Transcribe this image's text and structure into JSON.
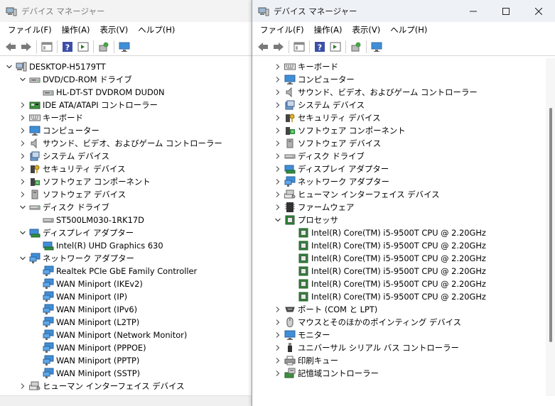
{
  "left": {
    "title": "デバイス マネージャー",
    "menu": [
      "ファイル(F)",
      "操作(A)",
      "表示(V)",
      "ヘルプ(H)"
    ],
    "tree": [
      {
        "level": 0,
        "exp": "open",
        "icon": "computer-icon",
        "label": "DESKTOP-H5179TT"
      },
      {
        "level": 1,
        "exp": "open",
        "icon": "dvd-drive-icon",
        "label": "DVD/CD-ROM ドライブ"
      },
      {
        "level": 2,
        "exp": "",
        "icon": "dvd-drive-icon",
        "label": "HL-DT-ST DVDROM DUD0N"
      },
      {
        "level": 1,
        "exp": "closed",
        "icon": "ide-controller-icon",
        "label": "IDE ATA/ATAPI コントローラー"
      },
      {
        "level": 1,
        "exp": "closed",
        "icon": "keyboard-icon",
        "label": "キーボード"
      },
      {
        "level": 1,
        "exp": "closed",
        "icon": "monitor-icon",
        "label": "コンピューター"
      },
      {
        "level": 1,
        "exp": "closed",
        "icon": "speaker-icon",
        "label": "サウンド、ビデオ、およびゲーム コントローラー"
      },
      {
        "level": 1,
        "exp": "closed",
        "icon": "system-device-icon",
        "label": "システム デバイス"
      },
      {
        "level": 1,
        "exp": "closed",
        "icon": "security-device-icon",
        "label": "セキュリティ デバイス"
      },
      {
        "level": 1,
        "exp": "closed",
        "icon": "software-component-icon",
        "label": "ソフトウェア コンポーネント"
      },
      {
        "level": 1,
        "exp": "closed",
        "icon": "software-device-icon",
        "label": "ソフトウェア デバイス"
      },
      {
        "level": 1,
        "exp": "open",
        "icon": "disk-drive-icon",
        "label": "ディスク ドライブ"
      },
      {
        "level": 2,
        "exp": "",
        "icon": "disk-drive-icon",
        "label": "ST500LM030-1RK17D"
      },
      {
        "level": 1,
        "exp": "open",
        "icon": "display-adapter-icon",
        "label": "ディスプレイ アダプター"
      },
      {
        "level": 2,
        "exp": "",
        "icon": "display-adapter-icon",
        "label": "Intel(R) UHD Graphics 630"
      },
      {
        "level": 1,
        "exp": "open",
        "icon": "network-adapter-icon",
        "label": "ネットワーク アダプター"
      },
      {
        "level": 2,
        "exp": "",
        "icon": "network-adapter-icon",
        "label": "Realtek PCIe GbE Family Controller"
      },
      {
        "level": 2,
        "exp": "",
        "icon": "network-adapter-icon",
        "label": "WAN Miniport (IKEv2)"
      },
      {
        "level": 2,
        "exp": "",
        "icon": "network-adapter-icon",
        "label": "WAN Miniport (IP)"
      },
      {
        "level": 2,
        "exp": "",
        "icon": "network-adapter-icon",
        "label": "WAN Miniport (IPv6)"
      },
      {
        "level": 2,
        "exp": "",
        "icon": "network-adapter-icon",
        "label": "WAN Miniport (L2TP)"
      },
      {
        "level": 2,
        "exp": "",
        "icon": "network-adapter-icon",
        "label": "WAN Miniport (Network Monitor)"
      },
      {
        "level": 2,
        "exp": "",
        "icon": "network-adapter-icon",
        "label": "WAN Miniport (PPPOE)"
      },
      {
        "level": 2,
        "exp": "",
        "icon": "network-adapter-icon",
        "label": "WAN Miniport (PPTP)"
      },
      {
        "level": 2,
        "exp": "",
        "icon": "network-adapter-icon",
        "label": "WAN Miniport (SSTP)"
      },
      {
        "level": 1,
        "exp": "closed",
        "icon": "hid-icon",
        "label": "ヒューマン インターフェイス デバイス"
      }
    ]
  },
  "right": {
    "title": "デバイス マネージャー",
    "menu": [
      "ファイル(F)",
      "操作(A)",
      "表示(V)",
      "ヘルプ(H)"
    ],
    "tree": [
      {
        "level": 1,
        "exp": "closed",
        "icon": "keyboard-icon",
        "label": "キーボード"
      },
      {
        "level": 1,
        "exp": "closed",
        "icon": "monitor-icon",
        "label": "コンピューター"
      },
      {
        "level": 1,
        "exp": "closed",
        "icon": "speaker-icon",
        "label": "サウンド、ビデオ、およびゲーム コントローラー"
      },
      {
        "level": 1,
        "exp": "closed",
        "icon": "system-device-icon",
        "label": "システム デバイス"
      },
      {
        "level": 1,
        "exp": "closed",
        "icon": "security-device-icon",
        "label": "セキュリティ デバイス"
      },
      {
        "level": 1,
        "exp": "closed",
        "icon": "software-component-icon",
        "label": "ソフトウェア コンポーネント"
      },
      {
        "level": 1,
        "exp": "closed",
        "icon": "software-device-icon",
        "label": "ソフトウェア デバイス"
      },
      {
        "level": 1,
        "exp": "closed",
        "icon": "disk-drive-icon",
        "label": "ディスク ドライブ"
      },
      {
        "level": 1,
        "exp": "closed",
        "icon": "display-adapter-icon",
        "label": "ディスプレイ アダプター"
      },
      {
        "level": 1,
        "exp": "closed",
        "icon": "network-adapter-icon",
        "label": "ネットワーク アダプター"
      },
      {
        "level": 1,
        "exp": "closed",
        "icon": "hid-icon",
        "label": "ヒューマン インターフェイス デバイス"
      },
      {
        "level": 1,
        "exp": "closed",
        "icon": "firmware-icon",
        "label": "ファームウェア"
      },
      {
        "level": 1,
        "exp": "open",
        "icon": "processor-icon",
        "label": "プロセッサ"
      },
      {
        "level": 2,
        "exp": "",
        "icon": "processor-icon",
        "label": "Intel(R) Core(TM) i5-9500T CPU @ 2.20GHz"
      },
      {
        "level": 2,
        "exp": "",
        "icon": "processor-icon",
        "label": "Intel(R) Core(TM) i5-9500T CPU @ 2.20GHz"
      },
      {
        "level": 2,
        "exp": "",
        "icon": "processor-icon",
        "label": "Intel(R) Core(TM) i5-9500T CPU @ 2.20GHz"
      },
      {
        "level": 2,
        "exp": "",
        "icon": "processor-icon",
        "label": "Intel(R) Core(TM) i5-9500T CPU @ 2.20GHz"
      },
      {
        "level": 2,
        "exp": "",
        "icon": "processor-icon",
        "label": "Intel(R) Core(TM) i5-9500T CPU @ 2.20GHz"
      },
      {
        "level": 2,
        "exp": "",
        "icon": "processor-icon",
        "label": "Intel(R) Core(TM) i5-9500T CPU @ 2.20GHz"
      },
      {
        "level": 1,
        "exp": "closed",
        "icon": "port-icon",
        "label": "ポート (COM と LPT)"
      },
      {
        "level": 1,
        "exp": "closed",
        "icon": "mouse-icon",
        "label": "マウスとそのほかのポインティング デバイス"
      },
      {
        "level": 1,
        "exp": "closed",
        "icon": "monitor-icon",
        "label": "モニター"
      },
      {
        "level": 1,
        "exp": "closed",
        "icon": "usb-icon",
        "label": "ユニバーサル シリアル バス コントローラー"
      },
      {
        "level": 1,
        "exp": "closed",
        "icon": "print-queue-icon",
        "label": "印刷キュー"
      },
      {
        "level": 1,
        "exp": "closed",
        "icon": "storage-controller-icon",
        "label": "記憶域コントローラー"
      }
    ]
  }
}
